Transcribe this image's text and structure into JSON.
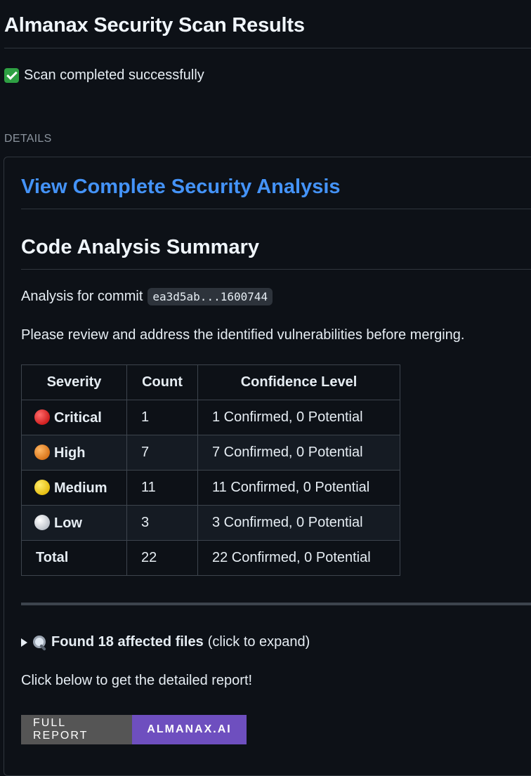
{
  "header": {
    "title": "Almanax Security Scan Results"
  },
  "status": {
    "icon": "check-mark-icon",
    "text": "Scan completed successfully"
  },
  "details": {
    "label": "DETAILS",
    "link_heading": "View Complete Security Analysis",
    "summary_heading": "Code Analysis Summary",
    "commit_prefix": "Analysis for commit",
    "commit_hash": "ea3d5ab...1600744",
    "review_text": "Please review and address the identified vulnerabilities before merging.",
    "table": {
      "headers": [
        "Severity",
        "Count",
        "Confidence Level"
      ],
      "rows": [
        {
          "severity": "Critical",
          "count": "1",
          "confidence": "1 Confirmed, 0 Potential",
          "icon": "red-circle-icon",
          "color": "#d01f1f"
        },
        {
          "severity": "High",
          "count": "7",
          "confidence": "7 Confirmed, 0 Potential",
          "icon": "orange-circle-icon",
          "color": "#d9761c"
        },
        {
          "severity": "Medium",
          "count": "11",
          "confidence": "11 Confirmed, 0 Potential",
          "icon": "yellow-circle-icon",
          "color": "#e6be12"
        },
        {
          "severity": "Low",
          "count": "3",
          "confidence": "3 Confirmed, 0 Potential",
          "icon": "white-circle-icon",
          "color": "#bfc4cc"
        },
        {
          "severity": "Total",
          "count": "22",
          "confidence": "22 Confirmed, 0 Potential"
        }
      ]
    },
    "expander": {
      "bold_text": "Found 18 affected files",
      "hint": "(click to expand)"
    },
    "cta_text": "Click below to get the detailed report!",
    "badge": {
      "left": "FULL REPORT",
      "right": "ALMANAX.AI",
      "left_color": "#555555",
      "right_color": "#6e4fbf"
    }
  },
  "colors": {
    "background": "#0d1117",
    "link": "#4493f8",
    "border": "#30363d"
  }
}
